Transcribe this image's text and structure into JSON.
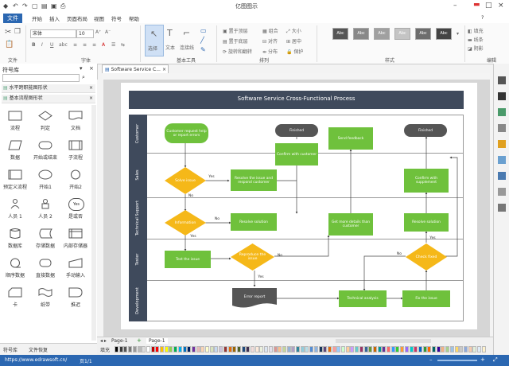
{
  "window": {
    "title": "亿图图示"
  },
  "menu": {
    "file": "文件",
    "items": [
      "开始",
      "插入",
      "页面布局",
      "视图",
      "符号",
      "帮助"
    ]
  },
  "ribbon": {
    "groups": [
      "文件",
      "字体",
      "基本工具",
      "排列",
      "样式",
      "编辑"
    ],
    "font_name": "宋体",
    "font_size": "10",
    "tools": {
      "select": "选择",
      "text": "文本",
      "connector": "连接线"
    },
    "arrange": [
      "置于顶层",
      "组合",
      "大小",
      "置于底层",
      "对齐",
      "居中",
      "旋转和翻转",
      "分布",
      "保护"
    ],
    "style_swatches": [
      "Abc",
      "Abc",
      "Abc",
      "Abc",
      "Abc",
      "Abc"
    ],
    "edit": [
      "填充",
      "线条",
      "阴影",
      "编辑"
    ]
  },
  "sidebar": {
    "title": "符号库",
    "libraries": [
      "水平跨职能图形状",
      "基本流程图形状"
    ],
    "shapes": [
      "流程",
      "判定",
      "文档",
      "数据",
      "开始或结束",
      "子流程",
      "预定义流程",
      "开始1",
      "开始2",
      "人员 1",
      "人员 2",
      "是或否",
      "数据库",
      "存储数据",
      "内部存储器",
      "顺序数据",
      "直接数据",
      "手动输入",
      "卡",
      "纸带",
      "推迟"
    ],
    "shapes_partial": "Yes",
    "footer_tabs": [
      "符号库",
      "文件恢复"
    ]
  },
  "document_tab": "Software Service C...",
  "diagram": {
    "title": "Software Service Cross-Functional Process",
    "lanes": [
      "Customer",
      "Sales",
      "Technical Support",
      "Tester",
      "Development"
    ],
    "nodes": {
      "customer_request": "Customer request help or report errors",
      "finished1": "Finished",
      "finished2": "Finished",
      "confirm_customer": "Confirm with customer",
      "send_feedback": "Send feedback",
      "confirm_supplement": "Confirm with supplement",
      "solve_issue": "Solve issue",
      "resolve_issue": "Resolve the issue and respond customer",
      "information": "Information",
      "resolve_solution1": "Resolve solution",
      "get_more_details": "Get more details than customer",
      "resolve_solution2": "Resolve solution",
      "test_issue": "Test the issue",
      "reproduce_issue": "Reproduce the issue",
      "check_fixed": "Check fixed",
      "error_report": "Error report",
      "technical_analysis": "Technical analysis",
      "fix_issue": "Fix the issue"
    },
    "edge_labels": {
      "yes1": "Yes",
      "no1": "No",
      "no2": "No",
      "yes2": "Yes",
      "no3": "No",
      "no4": "No",
      "yes3": "Yes",
      "yes4": "Yes"
    }
  },
  "pagebar": {
    "tab1": "Page-1",
    "add": "+",
    "tab2": "Page-1"
  },
  "colorbar": {
    "label": "填充"
  },
  "statusbar": {
    "url": "https://www.edrawsoft.cn/",
    "page": "页1/1"
  }
}
